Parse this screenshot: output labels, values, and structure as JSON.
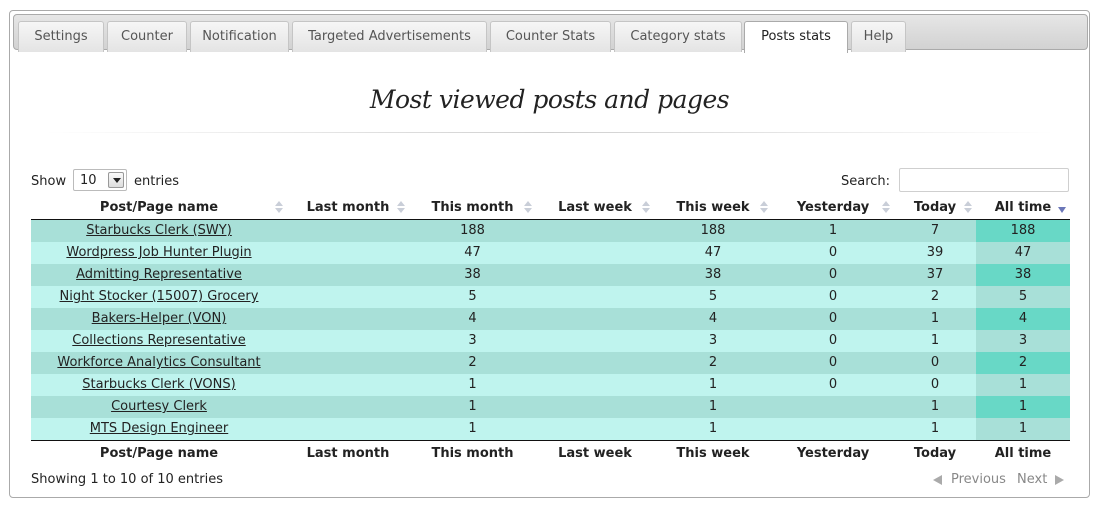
{
  "tabs": [
    {
      "label": "Settings",
      "active": false
    },
    {
      "label": "Counter",
      "active": false
    },
    {
      "label": "Notification",
      "active": false
    },
    {
      "label": "Targeted Advertisements",
      "active": false
    },
    {
      "label": "Counter Stats",
      "active": false
    },
    {
      "label": "Category stats",
      "active": false
    },
    {
      "label": "Posts stats",
      "active": true
    },
    {
      "label": "Help",
      "active": false
    }
  ],
  "heading": "Most viewed posts and pages",
  "controls": {
    "show_label": "Show",
    "entries_value": "10",
    "entries_label": "entries",
    "search_label": "Search:",
    "search_value": ""
  },
  "table": {
    "columns": [
      "Post/Page name",
      "Last month",
      "This month",
      "Last week",
      "This week",
      "Yesterday",
      "Today",
      "All time"
    ],
    "sorted_column": "All time",
    "sort_direction": "descending",
    "rows": [
      [
        "Starbucks Clerk (SWY)",
        "",
        "188",
        "",
        "188",
        "1",
        "7",
        "188"
      ],
      [
        "Wordpress Job Hunter Plugin",
        "",
        "47",
        "",
        "47",
        "0",
        "39",
        "47"
      ],
      [
        "Admitting Representative",
        "",
        "38",
        "",
        "38",
        "0",
        "37",
        "38"
      ],
      [
        "Night Stocker (15007) Grocery",
        "",
        "5",
        "",
        "5",
        "0",
        "2",
        "5"
      ],
      [
        "Bakers-Helper (VON)",
        "",
        "4",
        "",
        "4",
        "0",
        "1",
        "4"
      ],
      [
        "Collections Representative",
        "",
        "3",
        "",
        "3",
        "0",
        "1",
        "3"
      ],
      [
        "Workforce Analytics Consultant",
        "",
        "2",
        "",
        "2",
        "0",
        "0",
        "2"
      ],
      [
        "Starbucks Clerk (VONS)",
        "",
        "1",
        "",
        "1",
        "0",
        "0",
        "1"
      ],
      [
        "Courtesy Clerk",
        "",
        "1",
        "",
        "1",
        "",
        "1",
        "1"
      ],
      [
        "MTS Design Engineer",
        "",
        "1",
        "",
        "1",
        "",
        "1",
        "1"
      ]
    ]
  },
  "footer": {
    "info": "Showing 1 to 10 of 10 entries",
    "previous": "Previous",
    "next": "Next"
  },
  "colors": {
    "row_odd": "#a8e0d8",
    "row_even": "#bff4ee",
    "sorted_odd": "#68d8c6",
    "sorted_even": "#a8e0d8",
    "sort_indicator": "#6b77b8"
  }
}
